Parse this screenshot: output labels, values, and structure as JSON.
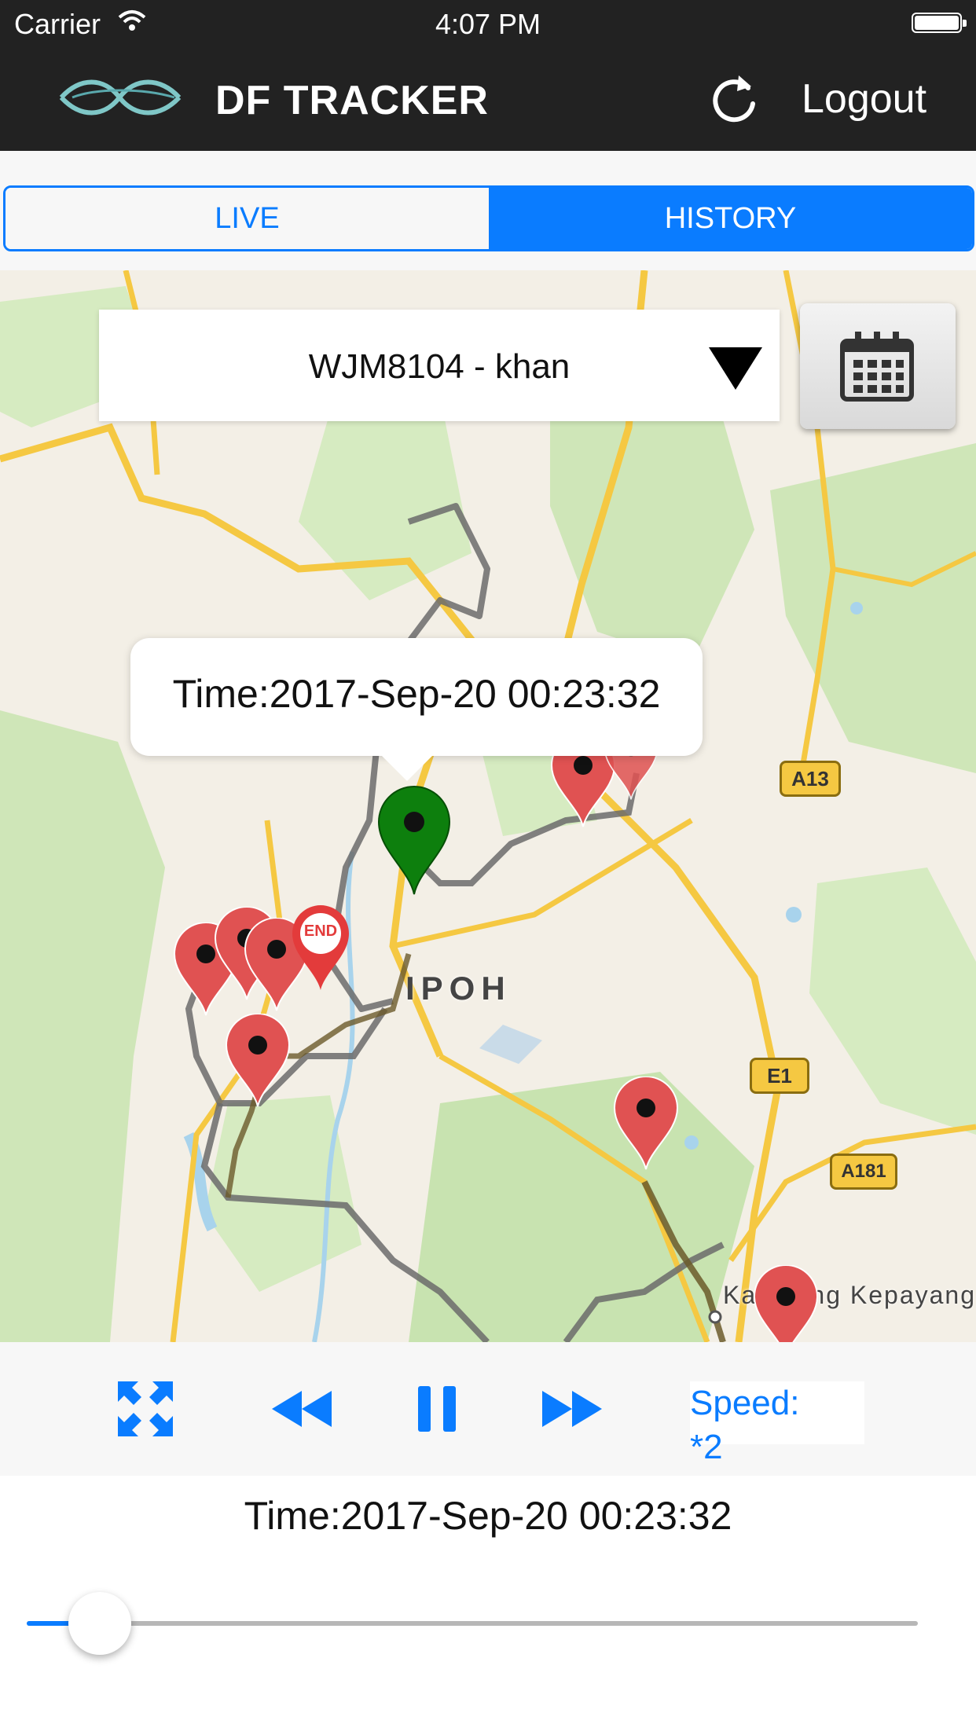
{
  "status_bar": {
    "carrier": "Carrier",
    "time": "4:07 PM"
  },
  "nav": {
    "title": "DF TRACKER",
    "logout_label": "Logout"
  },
  "tabs": [
    {
      "label": "LIVE",
      "selected": false
    },
    {
      "label": "HISTORY",
      "selected": true
    }
  ],
  "vehicle_selector": {
    "selected": "WJM8104 - khan"
  },
  "map": {
    "city_label": "IPOH",
    "place_label": "Kampung Kepayang",
    "road_shields": [
      "A13",
      "E1",
      "A181"
    ],
    "callout_time": "Time:2017-Sep-20 00:23:32",
    "end_marker_text": "END"
  },
  "playback": {
    "speed_label": "Speed:",
    "speed_value": "*2",
    "time": "Time:2017-Sep-20 00:23:32",
    "progress": 0.05
  },
  "colors": {
    "accent": "#0a7cff",
    "navbar": "#222222",
    "marker_red": "#e05252",
    "marker_green": "#0d7f0d"
  }
}
